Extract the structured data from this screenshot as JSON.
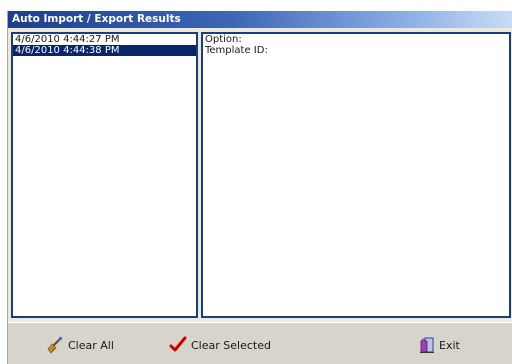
{
  "window": {
    "title": "Auto Import / Export Results"
  },
  "results_list": {
    "items": [
      {
        "label": "4/6/2010 4:44:27 PM",
        "selected": false
      },
      {
        "label": "4/6/2010 4:44:38 PM",
        "selected": true
      }
    ]
  },
  "details": {
    "option_label": "Option:",
    "template_id_label": "Template ID:"
  },
  "toolbar": {
    "clear_all_label": "Clear All",
    "clear_all_icon": "broom-icon",
    "clear_selected_label": "Clear Selected",
    "clear_selected_icon": "checkmark-icon",
    "exit_label": "Exit",
    "exit_icon": "door-exit-icon"
  },
  "colors": {
    "title_bar_start": "#1d3f8a",
    "title_bar_end": "#c9dcf6",
    "pane_border": "#1c3d7a",
    "selection": "#0a246a",
    "toolbar_bg": "#d7d4cb",
    "checkmark": "#cc0000"
  }
}
